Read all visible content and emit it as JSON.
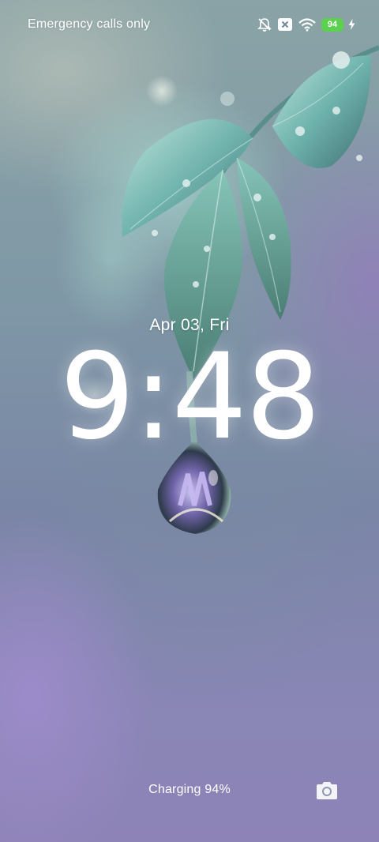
{
  "status_bar": {
    "carrier": "Emergency calls only",
    "battery_level": "94",
    "icons": [
      "muted-bell-icon",
      "no-sim-icon",
      "wifi-icon",
      "battery-icon",
      "charging-bolt-icon"
    ],
    "battery_color": "#5bd14f"
  },
  "lockscreen": {
    "date": "Apr 03, Fri",
    "time": "9:48",
    "charging_status": "Charging 94%"
  },
  "shortcuts": {
    "camera_icon": "camera-icon"
  },
  "wallpaper": {
    "description_icon": "leaf-water-drop-wallpaper"
  }
}
